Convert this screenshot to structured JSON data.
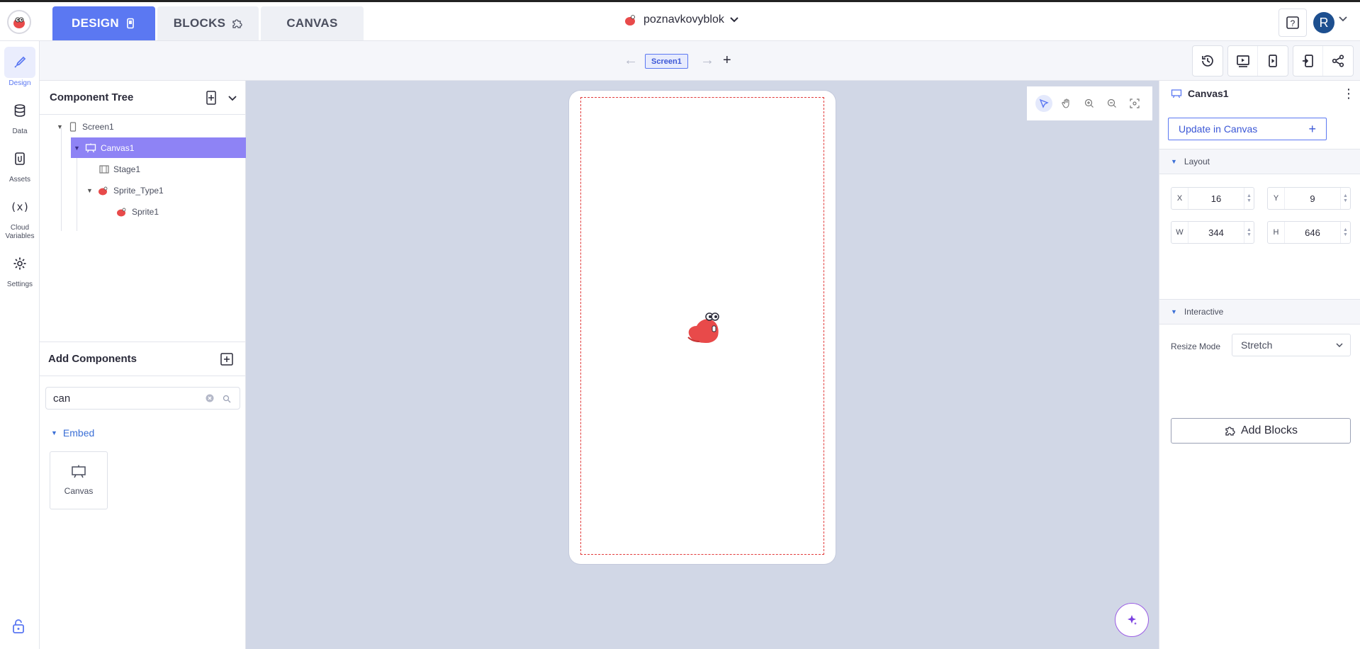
{
  "header": {
    "tabs": [
      {
        "label": "DESIGN",
        "active": true
      },
      {
        "label": "BLOCKS",
        "active": false
      },
      {
        "label": "CANVAS",
        "active": false
      }
    ],
    "project_name": "poznavkovyblok",
    "avatar_initial": "R",
    "accent_color": "#5b78f2"
  },
  "rail": {
    "items": [
      {
        "label": "Design",
        "icon": "brush-icon",
        "active": true
      },
      {
        "label": "Data",
        "icon": "database-icon",
        "active": false
      },
      {
        "label": "Assets",
        "icon": "clip-icon",
        "active": false
      },
      {
        "label": "Cloud Variables",
        "icon": "variable-icon",
        "glyph": "(x)",
        "active": false
      },
      {
        "label": "Settings",
        "icon": "gear-icon",
        "active": false
      }
    ]
  },
  "subbar": {
    "screen_chip": "Screen1"
  },
  "component_tree": {
    "title": "Component Tree",
    "nodes": [
      {
        "label": "Screen1",
        "depth": 0,
        "expanded": true,
        "icon": "phone-icon"
      },
      {
        "label": "Canvas1",
        "depth": 1,
        "expanded": true,
        "selected": true,
        "icon": "canvas-icon"
      },
      {
        "label": "Stage1",
        "depth": 2,
        "icon": "stage-icon"
      },
      {
        "label": "Sprite_Type1",
        "depth": 2,
        "expanded": true,
        "icon": "sprite-icon"
      },
      {
        "label": "Sprite1",
        "depth": 3,
        "icon": "sprite-icon"
      }
    ]
  },
  "add_components": {
    "title": "Add Components",
    "search_value": "can",
    "category": "Embed",
    "items": [
      {
        "label": "Canvas",
        "icon": "canvas-icon"
      }
    ]
  },
  "properties": {
    "component_name": "Canvas1",
    "update_button": "Update in Canvas",
    "layout_section": "Layout",
    "fields": [
      {
        "label": "X",
        "value": "16"
      },
      {
        "label": "Y",
        "value": "9"
      },
      {
        "label": "W",
        "value": "344"
      },
      {
        "label": "H",
        "value": "646"
      }
    ],
    "resize_mode_label": "Resize Mode",
    "resize_mode_value": "Stretch",
    "interactive_section": "Interactive",
    "add_blocks_button": "Add Blocks"
  }
}
